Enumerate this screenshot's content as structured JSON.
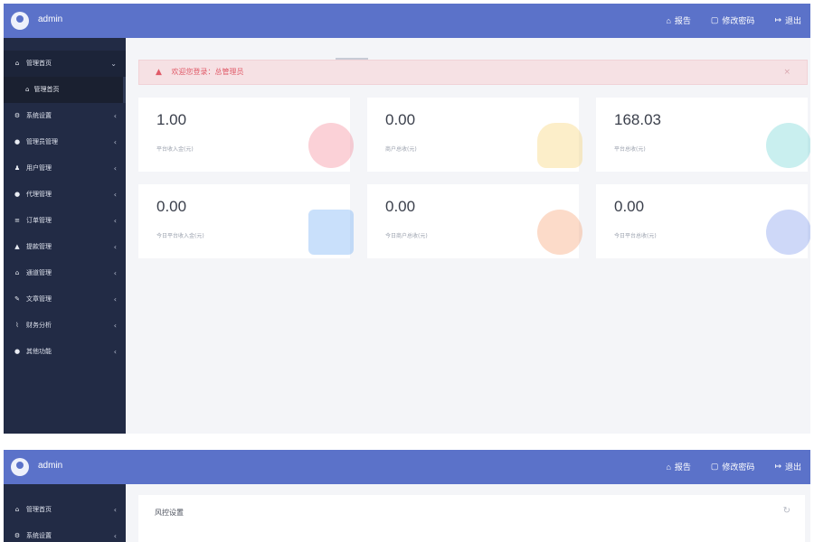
{
  "screen1": {
    "header": {
      "username": "admin",
      "actions": [
        {
          "label": "报告",
          "icon": "home-icon"
        },
        {
          "label": "修改密码",
          "icon": "lock-icon"
        },
        {
          "label": "退出",
          "icon": "logout-icon"
        }
      ]
    },
    "sidebar": {
      "items": [
        {
          "label": "管理首页",
          "icon": "home-icon",
          "expanded": true
        },
        {
          "label": "系统设置",
          "icon": "settings-icon"
        },
        {
          "label": "管理员管理",
          "icon": "user-icon"
        },
        {
          "label": "用户管理",
          "icon": "users-icon"
        },
        {
          "label": "代理管理",
          "icon": "user-icon"
        },
        {
          "label": "订单管理",
          "icon": "list-icon"
        },
        {
          "label": "提款管理",
          "icon": "pin-icon"
        },
        {
          "label": "通道管理",
          "icon": "bank-icon"
        },
        {
          "label": "文章管理",
          "icon": "edit-icon"
        },
        {
          "label": "财务分析",
          "icon": "chart-icon"
        },
        {
          "label": "其他功能",
          "icon": "user-icon"
        }
      ],
      "subitems": [
        {
          "label": "管理首页",
          "icon": "home-icon"
        }
      ]
    },
    "alert": {
      "text": "欢迎您登录：总管理员"
    },
    "stats": [
      {
        "value": "1.00",
        "label": "平台收入金(元)",
        "color": "#ef5a6f"
      },
      {
        "value": "0.00",
        "label": "商户总收(元)",
        "color": "#f3c23c"
      },
      {
        "value": "168.03",
        "label": "平台总收(元)",
        "color": "#3cc6c5"
      },
      {
        "value": "0.00",
        "label": "今日平台收入金(元)",
        "color": "#3e8ef0"
      },
      {
        "value": "0.00",
        "label": "今日商户总收(元)",
        "color": "#f57f3c"
      },
      {
        "value": "0.00",
        "label": "今日平台总收(元)",
        "color": "#4e72e6"
      }
    ]
  },
  "screen2": {
    "header": {
      "username": "admin",
      "actions": [
        {
          "label": "报告",
          "icon": "home-icon"
        },
        {
          "label": "修改密码",
          "icon": "lock-icon"
        },
        {
          "label": "退出",
          "icon": "logout-icon"
        }
      ]
    },
    "sidebar": {
      "items": [
        {
          "label": "管理首页",
          "icon": "home-icon"
        },
        {
          "label": "系统设置",
          "icon": "settings-icon"
        }
      ]
    },
    "panel": {
      "title": "风控设置"
    }
  },
  "colors": {
    "topbar": "#5b72c9",
    "sidebar": "#222b45",
    "alert_bg": "#f6e1e4",
    "alert_text": "#e05a68"
  }
}
